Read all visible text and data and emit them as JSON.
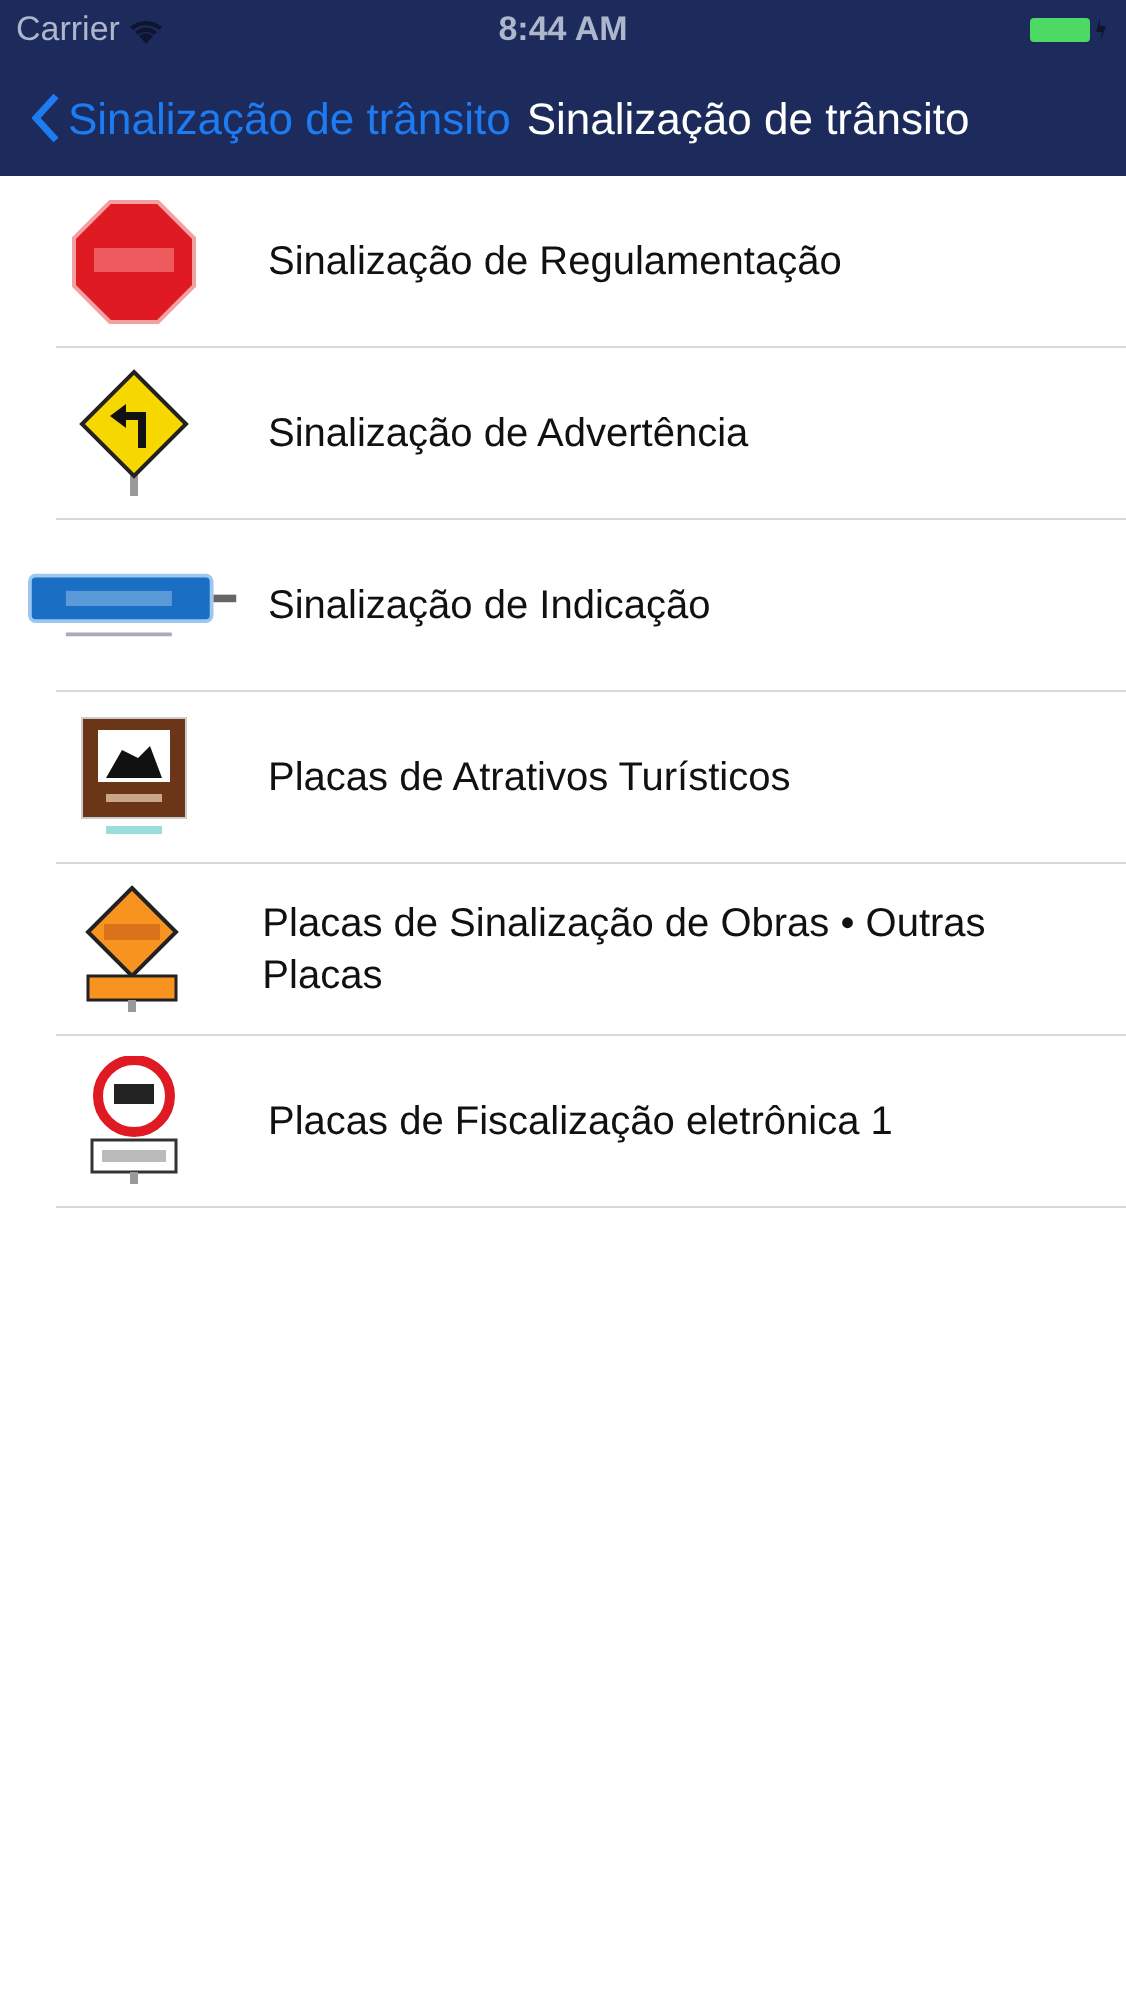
{
  "status_bar": {
    "carrier": "Carrier",
    "time": "8:44 AM"
  },
  "nav": {
    "back": "Sinalização de trânsito",
    "title": "Sinalização de trânsito"
  },
  "items": [
    {
      "kind": "stop",
      "label": "Sinalização de Regulamentação"
    },
    {
      "kind": "warning",
      "label": "Sinalização de Advertência"
    },
    {
      "kind": "guide",
      "label": "Sinalização de Indicação"
    },
    {
      "kind": "tourism",
      "label": "Placas de Atrativos Turísticos"
    },
    {
      "kind": "works",
      "label": "Placas de Sinalização de Obras • Outras Placas"
    },
    {
      "kind": "speed",
      "label": "Placas de Fiscalização eletrônica 1"
    }
  ]
}
